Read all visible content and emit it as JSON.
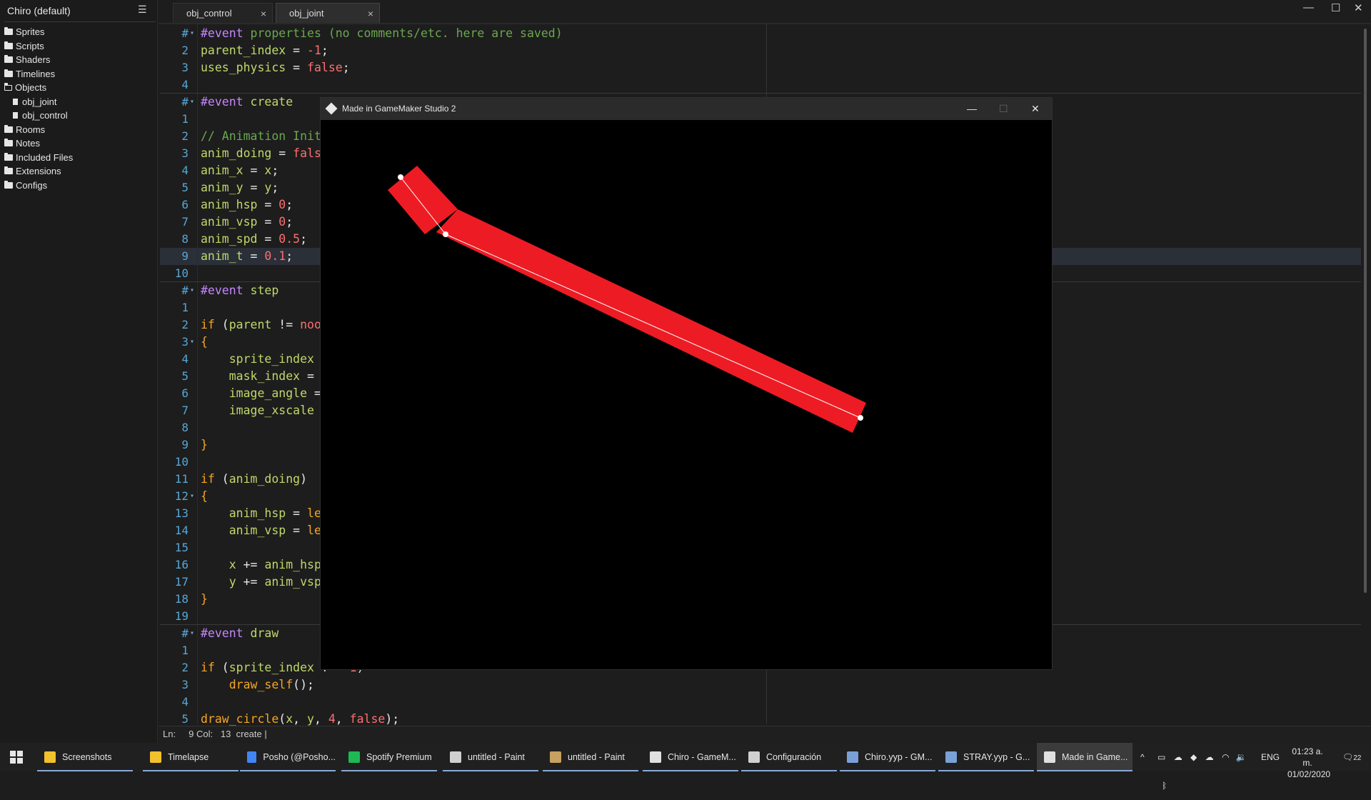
{
  "project": {
    "title": "Chiro (default)"
  },
  "sidebar": {
    "items": [
      {
        "label": "Sprites",
        "type": "folder"
      },
      {
        "label": "Scripts",
        "type": "folder"
      },
      {
        "label": "Shaders",
        "type": "folder"
      },
      {
        "label": "Timelines",
        "type": "folder"
      },
      {
        "label": "Objects",
        "type": "folder-open"
      },
      {
        "label": "obj_joint",
        "type": "file"
      },
      {
        "label": "obj_control",
        "type": "file"
      },
      {
        "label": "Rooms",
        "type": "folder"
      },
      {
        "label": "Notes",
        "type": "folder"
      },
      {
        "label": "Included Files",
        "type": "folder"
      },
      {
        "label": "Extensions",
        "type": "folder"
      },
      {
        "label": "Configs",
        "type": "folder"
      }
    ]
  },
  "tabs": [
    {
      "label": "obj_control",
      "close": "×"
    },
    {
      "label": "obj_joint",
      "close": "×"
    }
  ],
  "window_controls": {
    "minimize": "—",
    "maximize": "☐",
    "close": "✕"
  },
  "editor": {
    "lines": [
      {
        "ln": "#",
        "fold": "▾",
        "html": "<span class='ev'>#event</span> <span class='cm'>properties (no comments/etc. here are saved)</span>"
      },
      {
        "ln": "2",
        "html": "<span class='vv'>parent_index</span> = <span class='num'>-1</span>;"
      },
      {
        "ln": "3",
        "html": "<span class='vv'>uses_physics</span> = <span class='bl'>false</span>;"
      },
      {
        "ln": "4",
        "html": ""
      },
      {
        "ln": "#",
        "fold": "▾",
        "html": "<span class='ev'>#event</span> <span class='vv'>create</span>"
      },
      {
        "ln": "1",
        "html": ""
      },
      {
        "ln": "2",
        "html": "<span class='cm'>// Animation Init</span>"
      },
      {
        "ln": "3",
        "html": "<span class='vv'>anim_doing</span> = <span class='bl'>fals</span>"
      },
      {
        "ln": "4",
        "html": "<span class='vv'>anim_x</span> = <span class='vv'>x</span>;"
      },
      {
        "ln": "5",
        "html": "<span class='vv'>anim_y</span> = <span class='vv'>y</span>;"
      },
      {
        "ln": "6",
        "html": "<span class='vv'>anim_hsp</span> = <span class='num'>0</span>;"
      },
      {
        "ln": "7",
        "html": "<span class='vv'>anim_vsp</span> = <span class='num'>0</span>;"
      },
      {
        "ln": "8",
        "html": "<span class='vv'>anim_spd</span> = <span class='num'>0.5</span>;"
      },
      {
        "ln": "9",
        "html": "<span class='vv'>anim_t</span> = <span class='num'>0.1</span>;"
      },
      {
        "ln": "10",
        "html": ""
      },
      {
        "ln": "#",
        "fold": "▾",
        "html": "<span class='ev'>#event</span> <span class='vv'>step</span>"
      },
      {
        "ln": "1",
        "html": ""
      },
      {
        "ln": "2",
        "html": "<span class='kw'>if</span> (<span class='vv'>parent</span> != <span class='num'>noo</span>"
      },
      {
        "ln": "3",
        "fold": "▾",
        "html": "<span class='kw'>{</span>"
      },
      {
        "ln": "4",
        "html": "    <span class='vv'>sprite_index</span>"
      },
      {
        "ln": "5",
        "html": "    <span class='vv'>mask_index</span> ="
      },
      {
        "ln": "6",
        "html": "    <span class='vv'>image_angle</span> ="
      },
      {
        "ln": "7",
        "html": "    <span class='vv'>image_xscale</span>"
      },
      {
        "ln": "8",
        "html": ""
      },
      {
        "ln": "9",
        "html": "<span class='kw'>}</span>"
      },
      {
        "ln": "10",
        "html": ""
      },
      {
        "ln": "11",
        "html": "<span class='kw'>if</span> (<span class='vv'>anim_doing</span>)"
      },
      {
        "ln": "12",
        "fold": "▾",
        "html": "<span class='kw'>{</span>"
      },
      {
        "ln": "13",
        "html": "    <span class='vv'>anim_hsp</span> = <span class='kw'>le</span>"
      },
      {
        "ln": "14",
        "html": "    <span class='vv'>anim_vsp</span> = <span class='kw'>le</span>"
      },
      {
        "ln": "15",
        "html": ""
      },
      {
        "ln": "16",
        "html": "    <span class='vv'>x</span> += <span class='vv'>anim_hsp</span>"
      },
      {
        "ln": "17",
        "html": "    <span class='vv'>y</span> += <span class='vv'>anim_vsp</span>"
      },
      {
        "ln": "18",
        "html": "<span class='kw'>}</span>"
      },
      {
        "ln": "19",
        "html": ""
      },
      {
        "ln": "#",
        "fold": "▾",
        "html": "<span class='ev'>#event</span> <span class='vv'>draw</span>"
      },
      {
        "ln": "1",
        "html": ""
      },
      {
        "ln": "2",
        "html": "<span class='kw'>if</span> (<span class='vv'>sprite_index</span> != <span class='num'>-1</span>)"
      },
      {
        "ln": "3",
        "html": "    <span class='kw'>draw_self</span>();"
      },
      {
        "ln": "4",
        "html": ""
      },
      {
        "ln": "5",
        "html": "<span class='kw'>draw_circle</span>(<span class='vv'>x</span>, <span class='vv'>y</span>, <span class='num'>4</span>, <span class='bl'>false</span>);"
      }
    ]
  },
  "status": {
    "text": "Ln:     9 Col:   13  create |"
  },
  "game_window": {
    "title": "Made in GameMaker Studio 2",
    "controls": {
      "minimize": "—",
      "maximize": "☐",
      "close": "✕"
    },
    "colors": {
      "background": "#000000",
      "segment": "#ed1c24",
      "line": "#ffffff"
    }
  },
  "taskbar": {
    "items": [
      {
        "label": "Screenshots",
        "color": "#f2c12e"
      },
      {
        "label": "Timelapse",
        "color": "#f2c12e"
      },
      {
        "label": "Posho (@Posho...",
        "color": "#4285f4"
      },
      {
        "label": "Spotify Premium",
        "color": "#1db954"
      },
      {
        "label": "untitled - Paint",
        "color": "#d0d0d0"
      },
      {
        "label": "untitled - Paint",
        "color": "#c8a060"
      },
      {
        "label": "Chiro - GameM...",
        "color": "#e0e0e0"
      },
      {
        "label": "Configuración",
        "color": "#d0d0d0"
      },
      {
        "label": "Chiro.yyp - GM...",
        "color": "#7aa0d8"
      },
      {
        "label": "STRAY.yyp - G...",
        "color": "#7aa0d8"
      },
      {
        "label": "Made in Game...",
        "color": "#e0e0e0"
      }
    ],
    "tray": {
      "lang": "ENG",
      "time": "01:23 a. m.",
      "date": "01/02/2020",
      "notif": "22"
    }
  }
}
